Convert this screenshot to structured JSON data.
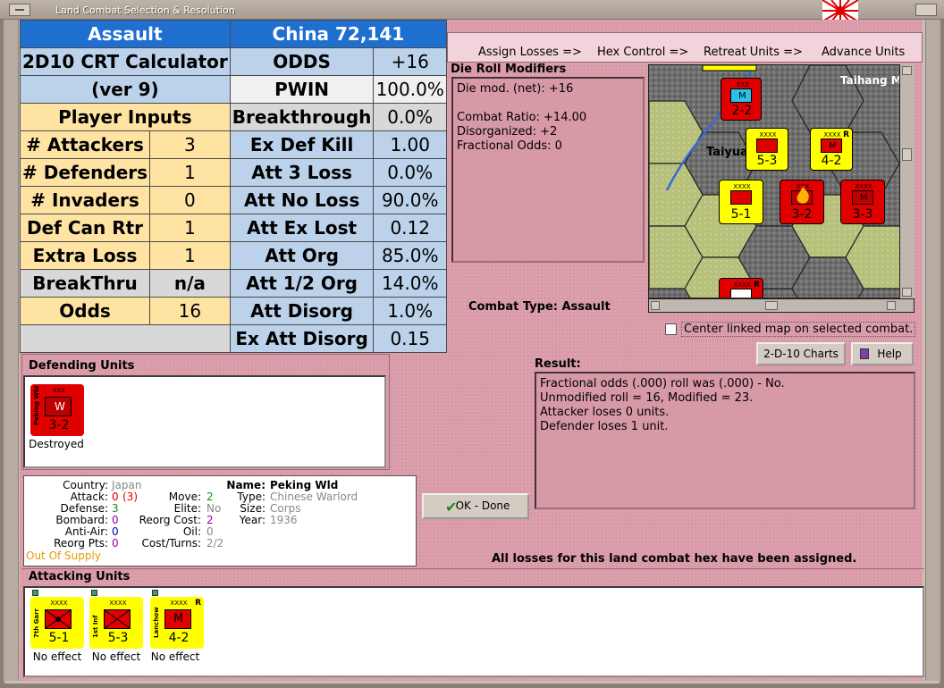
{
  "window": {
    "title": "Land Combat Selection & Resolution"
  },
  "colors": {
    "accent": "#1f6fd1",
    "panel": "#d99aa8",
    "yellow_unit": "#ffff00",
    "red_unit": "#e00000"
  },
  "crt": {
    "header_left": "Assault",
    "header_right": "China 72,141",
    "calc_title_1": "2D10 CRT Calculator",
    "calc_title_2": "(ver 9)",
    "player_inputs": "Player Inputs",
    "inputs": [
      {
        "label": "# Attackers",
        "value": "3"
      },
      {
        "label": "# Defenders",
        "value": "1"
      },
      {
        "label": "# Invaders",
        "value": "0"
      },
      {
        "label": "Def Can Rtr",
        "value": "1"
      },
      {
        "label": "Extra Loss",
        "value": "1"
      },
      {
        "label": "BreakThru",
        "value": "n/a"
      },
      {
        "label": "Odds",
        "value": "16"
      }
    ],
    "results": [
      {
        "label": "ODDS",
        "value": "+16"
      },
      {
        "label": "PWIN",
        "value": "100.0%"
      },
      {
        "label": "Breakthrough",
        "value": "0.0%"
      },
      {
        "label": "Ex Def Kill",
        "value": "1.00"
      },
      {
        "label": "Att 3 Loss",
        "value": "0.0%"
      },
      {
        "label": "Att No Loss",
        "value": "90.0%"
      },
      {
        "label": "Att Ex Lost",
        "value": "0.12"
      },
      {
        "label": "Att Org",
        "value": "85.0%"
      },
      {
        "label": "Att 1/2 Org",
        "value": "14.0%"
      },
      {
        "label": "Att Disorg",
        "value": "1.0%"
      },
      {
        "label": "Ex Att Disorg",
        "value": "0.15"
      }
    ]
  },
  "phases": [
    "Assign Losses =>",
    "Hex Control =>",
    "Retreat Units =>",
    "Advance Units"
  ],
  "die_roll": {
    "title": "Die Roll Modifiers",
    "lines": [
      "Die mod. (net): +16",
      "",
      "Combat Ratio: +14.00",
      "Disorganized: +2",
      "Fractional Odds: 0"
    ]
  },
  "combat_type": "Combat Type:  Assault",
  "map": {
    "labels": [
      "Taihang M",
      "Taiyua"
    ]
  },
  "center_linked": "Center linked map on selected combat.",
  "charts_button": "2-D-10 Charts",
  "help_button": "Help",
  "result": {
    "title": "Result:",
    "lines": [
      "Fractional odds (.000) roll was (.000)  - No.",
      "Unmodified roll = 16, Modified = 23.",
      "Attacker loses 0 units.",
      "Defender loses 1 unit."
    ]
  },
  "defending": {
    "title": "Defending Units",
    "units": [
      {
        "name": "Peking Wld",
        "size": "XXX",
        "sym": "W",
        "str": "3-2",
        "status": "Destroyed"
      }
    ]
  },
  "detail": {
    "country_k": "Country:",
    "country_v": "Japan",
    "attack_k": "Attack:",
    "attack_v": "0",
    "attack_v2": "(3)",
    "defense_k": "Defense:",
    "defense_v": "3",
    "bombard_k": "Bombard:",
    "bombard_v": "0",
    "antiair_k": "Anti-Air:",
    "antiair_v": "0",
    "reorg_k": "Reorg Pts:",
    "reorg_v": "0",
    "supply": "Out Of Supply",
    "move_k": "Move:",
    "move_v": "2",
    "elite_k": "Elite:",
    "elite_v": "No",
    "reorgcost_k": "Reorg Cost:",
    "reorgcost_v": "2",
    "oil_k": "Oil:",
    "oil_v": "0",
    "cost_k": "Cost/Turns:",
    "cost_v": "2/2",
    "name_k": "Name:",
    "name_v": "Peking Wld",
    "type_k": "Type:",
    "type_v": "Chinese Warlord",
    "size_k": "Size:",
    "size_v": "Corps",
    "year_k": "Year:",
    "year_v": "1936"
  },
  "ok_button": "OK - Done",
  "all_losses": "All losses for this land combat hex have been assigned.",
  "attacking": {
    "title": "Attacking Units",
    "units": [
      {
        "name": "7th Garr",
        "size": "XXXX",
        "sym": "",
        "str": "5-1",
        "status": "No effect",
        "r": ""
      },
      {
        "name": "1st Inf",
        "size": "XXXX",
        "sym": "",
        "str": "5-3",
        "status": "No effect",
        "r": ""
      },
      {
        "name": "Lanchow",
        "size": "XXXX",
        "sym": "M",
        "str": "4-2",
        "status": "No effect",
        "r": "R"
      }
    ]
  },
  "map_units": [
    {
      "size": "XXX",
      "sym": "M",
      "str": "2-2"
    },
    {
      "size": "XXXX",
      "sym": "",
      "str": "5-3"
    },
    {
      "size": "XXXX",
      "sym": "M",
      "str": "4-2",
      "r": "R"
    },
    {
      "size": "XXXX",
      "sym": "",
      "str": "5-1"
    },
    {
      "size": "XXX",
      "sym": "",
      "str": "3-2"
    },
    {
      "size": "XXXX",
      "sym": "M",
      "str": "3-3"
    },
    {
      "size": "XXXX",
      "sym": "",
      "str": "",
      "r": "R"
    }
  ]
}
